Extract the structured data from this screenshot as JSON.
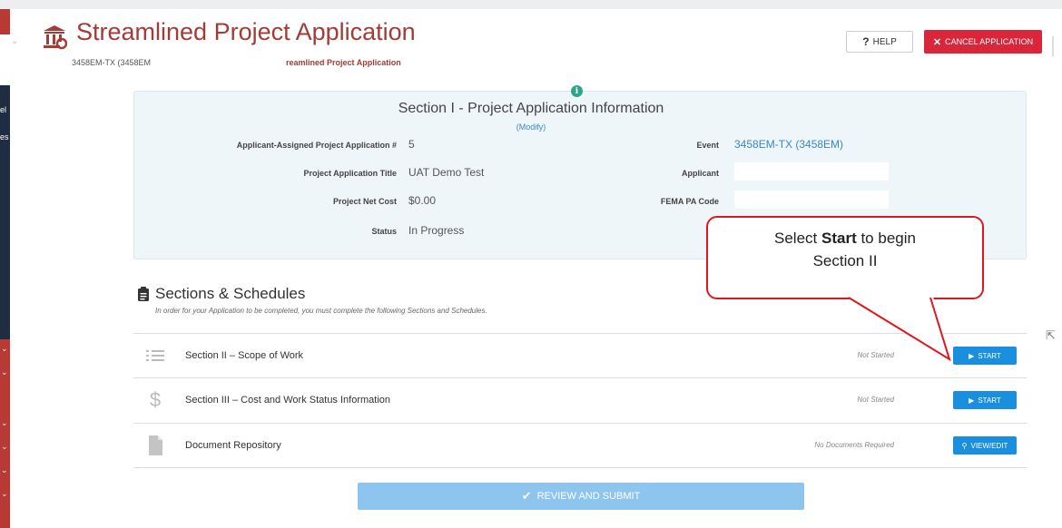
{
  "header": {
    "title": "Streamlined Project Application",
    "sub_left": "3458EM-TX (3458EM",
    "sub_mid": "reamlined Project Application",
    "help_label": "HELP",
    "cancel_label": "CANCEL APPLICATION"
  },
  "sidebar_fragments": [
    "el",
    "es"
  ],
  "info": {
    "title": "Section I - Project Application Information",
    "modify": "(Modify)",
    "fields": {
      "app_number_label": "Applicant-Assigned Project Application #",
      "app_number_value": "5",
      "title_label": "Project Application Title",
      "title_value": "UAT Demo Test",
      "net_cost_label": "Project Net Cost",
      "net_cost_value": "$0.00",
      "status_label": "Status",
      "status_value": "In Progress",
      "event_label": "Event",
      "event_value": "3458EM-TX (3458EM)",
      "applicant_label": "Applicant",
      "fema_label": "FEMA PA Code"
    }
  },
  "callout": {
    "pre": "Select ",
    "bold": "Start",
    "post": " to begin",
    "line2": "Section II"
  },
  "schedules": {
    "heading": "Sections & Schedules",
    "subtext": "In order for your Application to be completed, you must complete the following Sections and Schedules.",
    "rows": [
      {
        "label": "Section II – Scope of Work",
        "status": "Not Started",
        "button": "START"
      },
      {
        "label": "Section III – Cost and Work Status Information",
        "status": "Not Started",
        "button": "START"
      },
      {
        "label": "Document Repository",
        "status": "No Documents Required",
        "button": "VIEW/EDIT"
      }
    ]
  },
  "review_label": "REVIEW AND SUBMIT",
  "colors": {
    "brand_red": "#a33b36",
    "cancel_red": "#d9263a",
    "primary_blue": "#1a8fe0",
    "info_bg": "#eef6f9",
    "callout_border": "#e0161f"
  }
}
